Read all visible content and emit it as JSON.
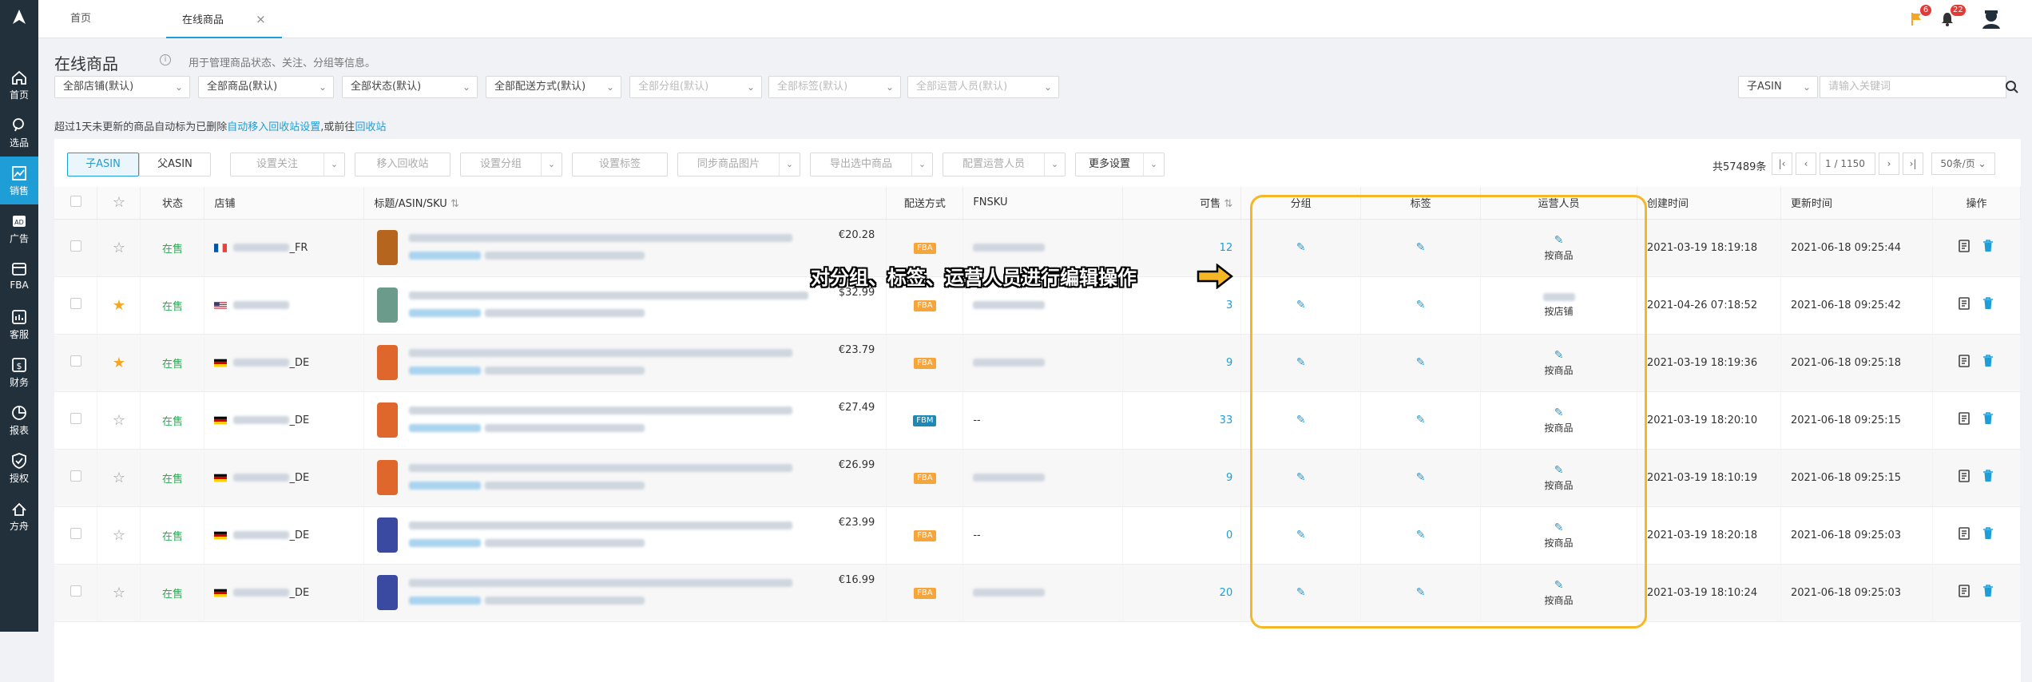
{
  "sidebar": {
    "items": [
      {
        "label": "首页",
        "icon": "home-icon"
      },
      {
        "label": "选品",
        "icon": "search-icon"
      },
      {
        "label": "销售",
        "icon": "chart-icon",
        "active": true
      },
      {
        "label": "广告",
        "icon": "ad-icon"
      },
      {
        "label": "FBA",
        "icon": "box-icon"
      },
      {
        "label": "客服",
        "icon": "chat-icon"
      },
      {
        "label": "财务",
        "icon": "dollar-icon"
      },
      {
        "label": "报表",
        "icon": "pie-icon"
      },
      {
        "label": "授权",
        "icon": "shield-icon"
      },
      {
        "label": "方舟",
        "icon": "ark-icon"
      }
    ]
  },
  "topbar": {
    "tabs": [
      {
        "label": "首页"
      },
      {
        "label": "在线商品",
        "active": true
      }
    ],
    "close_glyph": "×",
    "flag_badge": "6",
    "bell_badge": "22"
  },
  "page": {
    "title": "在线商品",
    "subtitle": "用于管理商品状态、关注、分组等信息。",
    "notice_prefix": "超过1天未更新的商品自动标为已删除",
    "notice_link1": "自动移入回收站设置",
    "notice_mid": ",或前往",
    "notice_link2": "回收站"
  },
  "filters": {
    "store": "全部店铺(默认)",
    "product": "全部商品(默认)",
    "status": "全部状态(默认)",
    "delivery": "全部配送方式(默认)",
    "group": "全部分组(默认)",
    "tag": "全部标签(默认)",
    "operator": "全部运营人员(默认)",
    "search_type": "子ASIN",
    "search_placeholder": "请输入关键词"
  },
  "toolbar": {
    "child_asin": "子ASIN",
    "parent_asin": "父ASIN",
    "set_follow": "设置关注",
    "move_recycle": "移入回收站",
    "set_group": "设置分组",
    "set_tag": "设置标签",
    "sync_images": "同步商品图片",
    "export": "导出选中商品",
    "set_operator": "配置运营人员",
    "more_settings": "更多设置"
  },
  "pagination": {
    "total": "共57489条",
    "current": "1",
    "pages": "/ 1150",
    "page_size": "50条/页"
  },
  "table": {
    "headers": {
      "status": "状态",
      "store": "店铺",
      "title": "标题/ASIN/SKU",
      "delivery": "配送方式",
      "fnsku": "FNSKU",
      "sellable": "可售",
      "group": "分组",
      "tag": "标签",
      "operator": "运营人员",
      "created": "创建时间",
      "updated": "更新时间",
      "actions": "操作"
    },
    "rows": [
      {
        "starred": false,
        "status": "在售",
        "country": "FR",
        "store_suffix": "_FR",
        "price": "€20.28",
        "delivery": "FBA",
        "fnsku": "",
        "sellable": "12",
        "operator": "按商品",
        "created": "2021-03-19 18:19:18",
        "updated": "2021-06-18 09:25:44",
        "thumb": "#b5651d"
      },
      {
        "starred": true,
        "status": "在售",
        "country": "US",
        "store_suffix": "",
        "price": "$32.99",
        "delivery": "FBA",
        "fnsku": "",
        "sellable": "3",
        "operator": "按店铺",
        "created": "2021-04-26 07:18:52",
        "updated": "2021-06-18 09:25:42",
        "thumb": "#6b9b8a"
      },
      {
        "starred": true,
        "status": "在售",
        "country": "DE",
        "store_suffix": "_DE",
        "price": "€23.79",
        "delivery": "FBA",
        "fnsku": "",
        "sellable": "9",
        "operator": "按商品",
        "created": "2021-03-19 18:19:36",
        "updated": "2021-06-18 09:25:18",
        "thumb": "#e0672b"
      },
      {
        "starred": false,
        "status": "在售",
        "country": "DE",
        "store_suffix": "_DE",
        "price": "€27.49",
        "delivery": "FBM",
        "fnsku": "--",
        "sellable": "33",
        "operator": "按商品",
        "created": "2021-03-19 18:20:10",
        "updated": "2021-06-18 09:25:15",
        "thumb": "#e0672b"
      },
      {
        "starred": false,
        "status": "在售",
        "country": "DE",
        "store_suffix": "_DE",
        "price": "€26.99",
        "delivery": "FBA",
        "fnsku": "",
        "sellable": "9",
        "operator": "按商品",
        "created": "2021-03-19 18:10:19",
        "updated": "2021-06-18 09:25:15",
        "thumb": "#e0672b"
      },
      {
        "starred": false,
        "status": "在售",
        "country": "DE",
        "store_suffix": "_DE",
        "price": "€23.99",
        "delivery": "FBA",
        "fnsku": "--",
        "sellable": "0",
        "operator": "按商品",
        "created": "2021-03-19 18:20:18",
        "updated": "2021-06-18 09:25:03",
        "thumb": "#3a4aa0"
      },
      {
        "starred": false,
        "status": "在售",
        "country": "DE",
        "store_suffix": "_DE",
        "price": "€16.99",
        "delivery": "FBA",
        "fnsku": "",
        "sellable": "20",
        "operator": "按商品",
        "created": "2021-03-19 18:10:24",
        "updated": "2021-06-18 09:25:03",
        "thumb": "#3a4aa0"
      }
    ]
  },
  "annotation": {
    "callout": "对分组、标签、运营人员进行编辑操作",
    "highlight_color": "#f6b726"
  },
  "colors": {
    "accent": "#1f9dd6",
    "sidebar_bg": "#22303c",
    "status_green": "#2aaa52",
    "fba_orange": "#f6a53a",
    "fbm_blue": "#1b8ab6"
  }
}
